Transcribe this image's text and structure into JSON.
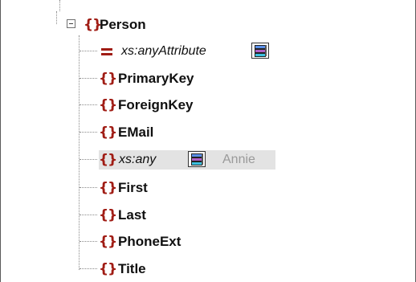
{
  "tree": {
    "root": {
      "label": "Person",
      "expander": "minus"
    },
    "children": [
      {
        "label": "xs:anyAttribute",
        "kind": "attribute-wildcard",
        "style": "italic"
      },
      {
        "label": "PrimaryKey",
        "kind": "element"
      },
      {
        "label": "ForeignKey",
        "kind": "element"
      },
      {
        "label": "EMail",
        "kind": "element"
      },
      {
        "label": "xs:any",
        "kind": "element-wildcard",
        "style": "italic",
        "selected": true,
        "value": "Annie"
      },
      {
        "label": "First",
        "kind": "element"
      },
      {
        "label": "Last",
        "kind": "element"
      },
      {
        "label": "PhoneExt",
        "kind": "element"
      },
      {
        "label": "Title",
        "kind": "element"
      }
    ]
  },
  "icons": {
    "element": "curly-braces-icon",
    "attribute": "equals-icon",
    "wildcard": "wildcard-list-icon",
    "expander": "minus-box-icon"
  },
  "colors": {
    "element_icon": "#a01c14",
    "selection_highlight": "#e3e3e3",
    "muted_value": "#9a9a9a"
  }
}
